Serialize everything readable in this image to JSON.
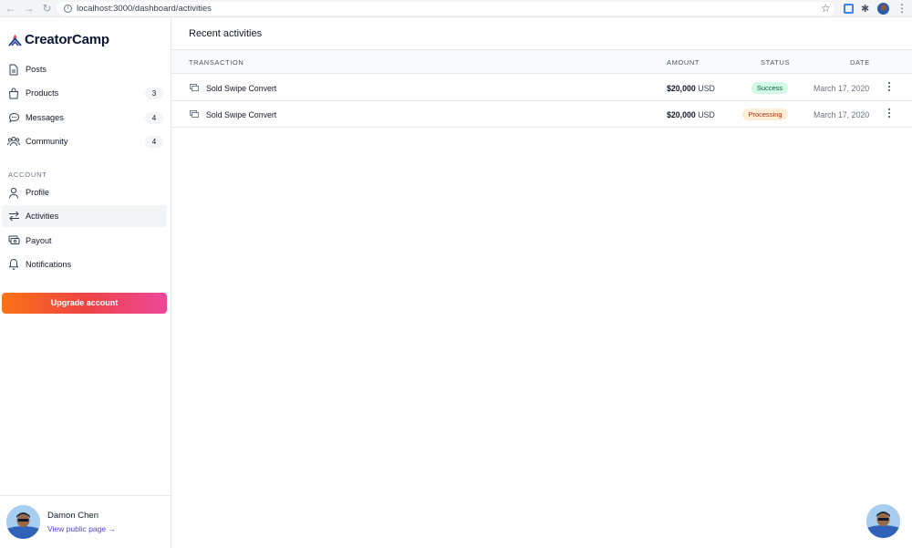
{
  "browser": {
    "url": "localhost:3000/dashboard/activities"
  },
  "brand": {
    "name": "CreatorCamp",
    "accent": "#ef4444"
  },
  "sidebar": {
    "items": [
      {
        "label": "Posts",
        "icon": "document-icon",
        "count": ""
      },
      {
        "label": "Products",
        "icon": "bag-icon",
        "count": "3"
      },
      {
        "label": "Messages",
        "icon": "chat-icon",
        "count": "4"
      },
      {
        "label": "Community",
        "icon": "users-icon",
        "count": "4"
      }
    ],
    "account_label": "ACCOUNT",
    "account_items": [
      {
        "label": "Profile",
        "icon": "user-icon"
      },
      {
        "label": "Activities",
        "icon": "switch-arrows-icon",
        "active": true
      },
      {
        "label": "Payout",
        "icon": "cash-icon"
      },
      {
        "label": "Notifications",
        "icon": "bell-icon"
      }
    ],
    "upgrade_label": "Upgrade account"
  },
  "user": {
    "name": "Damon Chen",
    "link": "View public page →"
  },
  "main": {
    "title": "Recent activities",
    "columns": {
      "transaction": "TRANSACTION",
      "amount": "AMOUNT",
      "status": "STATUS",
      "date": "DATE"
    },
    "rows": [
      {
        "name": "Sold Swipe Convert",
        "amount": "$20,000",
        "currency": "USD",
        "status": "Success",
        "date": "March 17, 2020"
      },
      {
        "name": "Sold Swipe Convert",
        "amount": "$20,000",
        "currency": "USD",
        "status": "Processing",
        "date": "March 17, 2020"
      }
    ],
    "status_colors": {
      "success_bg": "#d1fae5",
      "processing_bg": "#ffedd5"
    }
  }
}
